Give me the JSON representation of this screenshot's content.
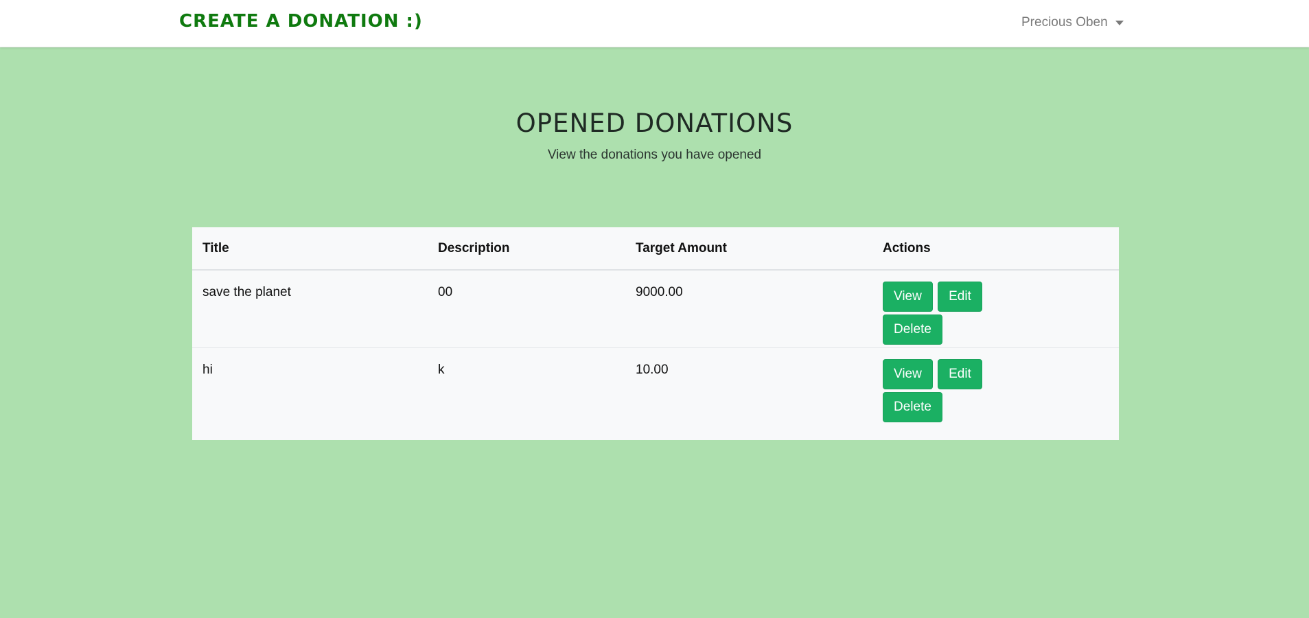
{
  "navbar": {
    "brand": "CREATE A DONATION :)",
    "user_name": "Precious Oben"
  },
  "header": {
    "title": "OPENED DONATIONS",
    "subtitle": "View the donations you have opened"
  },
  "table": {
    "columns": [
      "Title",
      "Description",
      "Target Amount",
      "Actions"
    ],
    "rows": [
      {
        "title": "save the planet",
        "description": "00",
        "target_amount": "9000.00"
      },
      {
        "title": "hi",
        "description": "k",
        "target_amount": "10.00"
      }
    ],
    "actions": {
      "view_label": "View",
      "edit_label": "Edit",
      "delete_label": "Delete"
    }
  },
  "colors": {
    "background": "#ade0ae",
    "brand": "#0f7a0f",
    "button": "#1bb063"
  },
  "icons": {
    "user_menu": "chevron-down-icon"
  }
}
